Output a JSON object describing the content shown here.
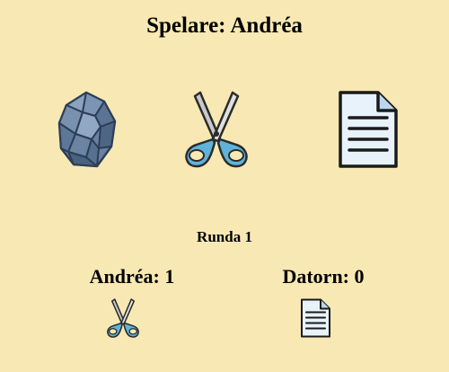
{
  "header": {
    "player_label": "Spelare",
    "player_name": "Andréa",
    "title": "Spelare: Andréa"
  },
  "choices": [
    {
      "name": "rock-icon",
      "label": ""
    },
    {
      "name": "scissors-icon",
      "label": ""
    },
    {
      "name": "paper-icon",
      "label": ""
    }
  ],
  "round": {
    "text": "Runda 1"
  },
  "scores": {
    "player": {
      "text": "Andréa: 1",
      "name": "Andréa",
      "points": 1,
      "last_pick": "scissors-icon"
    },
    "computer": {
      "text": "Datorn: 0",
      "name": "Datorn",
      "points": 0,
      "last_pick": "paper-icon"
    }
  },
  "colors": {
    "background": "#f8e8b4",
    "scissors_handle": "#5fb3d9",
    "rock": "#5e7896",
    "paper": "#e8f2fb"
  }
}
